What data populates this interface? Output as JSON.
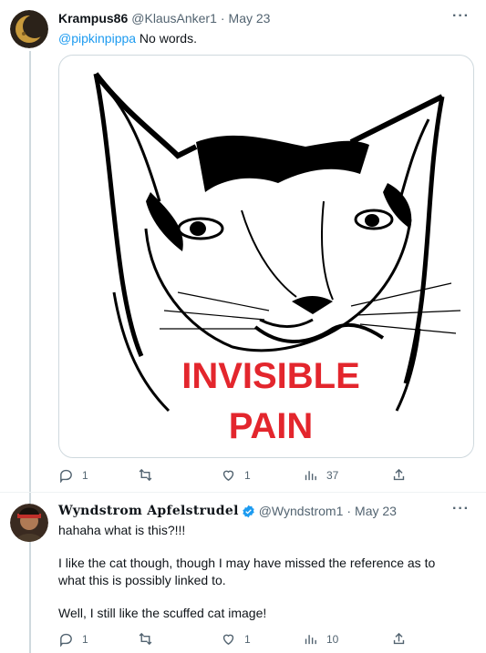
{
  "tweets": [
    {
      "display_name": "Krampus86",
      "handle": "@KlausAnker1",
      "separator": "·",
      "date": "May 23",
      "more": "···",
      "mention": "@pipkinpippa",
      "text": " No words.",
      "image_caption_line1": "INVISIBLE",
      "image_caption_line2": "PAIN",
      "actions": {
        "replies": "1",
        "retweets": "",
        "likes": "1",
        "views": "37"
      }
    },
    {
      "display_name": "Wyndstrom Apfelstrudel",
      "handle": "@Wyndstrom1",
      "separator": "·",
      "date": "May 23",
      "more": "···",
      "verified": true,
      "text_lines": [
        "hahaha what is this?!!!",
        "I like the cat though, though I may have missed the reference as to what this is possibly linked to.",
        "Well, I still like the scuffed cat image!"
      ],
      "actions": {
        "replies": "1",
        "retweets": "",
        "likes": "1",
        "views": "10"
      }
    }
  ],
  "colors": {
    "accent": "#1d9bf0",
    "muted": "#536471",
    "caption_red": "#e3262d",
    "border": "#cfd9de"
  }
}
